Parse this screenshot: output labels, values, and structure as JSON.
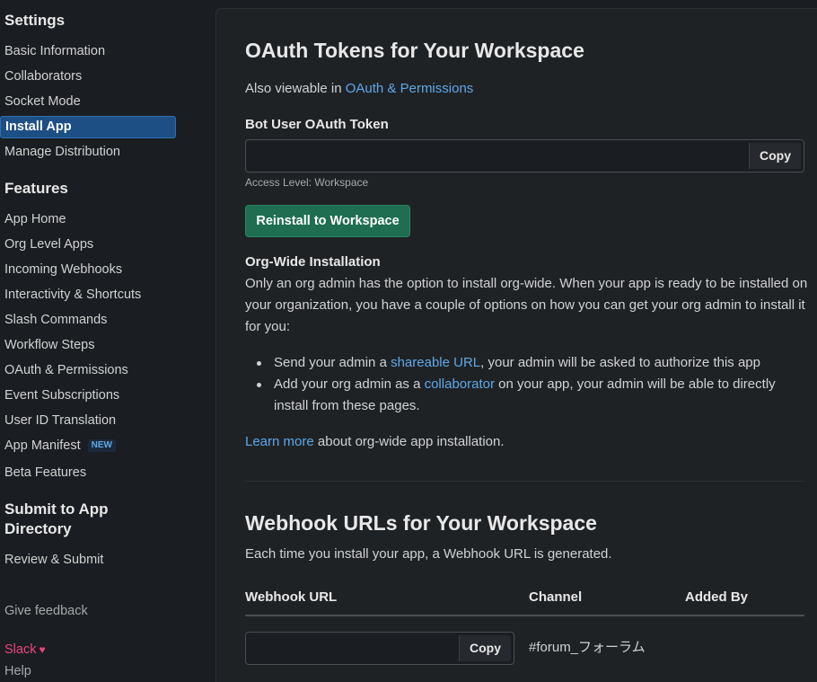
{
  "sidebar": {
    "settings_heading": "Settings",
    "settings_items": [
      {
        "label": "Basic Information"
      },
      {
        "label": "Collaborators"
      },
      {
        "label": "Socket Mode"
      },
      {
        "label": "Install App",
        "active": true
      },
      {
        "label": "Manage Distribution"
      }
    ],
    "features_heading": "Features",
    "features_items": [
      {
        "label": "App Home"
      },
      {
        "label": "Org Level Apps"
      },
      {
        "label": "Incoming Webhooks"
      },
      {
        "label": "Interactivity & Shortcuts"
      },
      {
        "label": "Slash Commands"
      },
      {
        "label": "Workflow Steps"
      },
      {
        "label": "OAuth & Permissions"
      },
      {
        "label": "Event Subscriptions"
      },
      {
        "label": "User ID Translation"
      },
      {
        "label": "App Manifest",
        "badge": "NEW"
      },
      {
        "label": "Beta Features"
      }
    ],
    "submit_heading_line1": "Submit to App",
    "submit_heading_line2": "Directory",
    "review_submit": "Review & Submit",
    "give_feedback": "Give feedback",
    "slack": "Slack",
    "heart_icon": "♥",
    "help": "Help"
  },
  "oauth": {
    "title": "OAuth Tokens for Your Workspace",
    "also_prefix": "Also viewable in ",
    "also_link": "OAuth & Permissions",
    "bot_token_label": "Bot User OAuth Token",
    "bot_token_value": "",
    "copy_label": "Copy",
    "access_level": "Access Level: Workspace",
    "reinstall_label": "Reinstall to Workspace"
  },
  "org_wide": {
    "heading": "Org-Wide Installation",
    "intro": "Only an org admin has the option to install org-wide. When your app is ready to be installed on your organization, you have a couple of options on how you can get your org admin to install it for you:",
    "bullet1_prefix": "Send your admin a ",
    "bullet1_link": "shareable URL",
    "bullet1_suffix": ", your admin will be asked to authorize this app",
    "bullet2_prefix": "Add your org admin as a ",
    "bullet2_link": "collaborator",
    "bullet2_suffix": " on your app, your admin will be able to directly install from these pages.",
    "learn_link": "Learn more",
    "learn_suffix": " about org-wide app installation."
  },
  "webhooks": {
    "title": "Webhook URLs for Your Workspace",
    "description": "Each time you install your app, a Webhook URL is generated.",
    "col_url": "Webhook URL",
    "col_channel": "Channel",
    "col_added_by": "Added By",
    "rows": [
      {
        "url": "",
        "copy": "Copy",
        "channel": "#forum_フォーラム",
        "added_by": ""
      }
    ]
  },
  "colors": {
    "background": "#1a1d21",
    "panel": "#1f2225",
    "active_item": "#1d4f85",
    "link": "#5ea8e8",
    "primary_button": "#1f6e52",
    "slack_pink": "#e8467c"
  }
}
